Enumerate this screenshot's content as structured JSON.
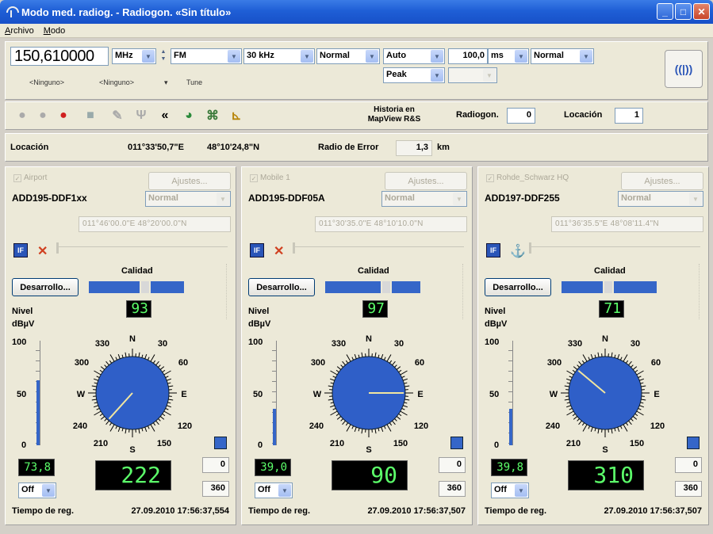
{
  "window": {
    "title": "Modo med. radiog. - Radiogon. «Sin título»",
    "controls": [
      "_",
      "□",
      "✕"
    ]
  },
  "menu": [
    "Archivo",
    "Modo"
  ],
  "receiver": {
    "frequency": "150,610000",
    "freq_unit": "MHz",
    "demod": "FM",
    "bandwidth": "30 kHz",
    "mode": "Normal",
    "agc": "Auto",
    "detector": "Peak",
    "time_value": "100,0",
    "time_unit": "ms",
    "mode2": "Normal",
    "sub1": "<Ninguno>",
    "sub2": "<Ninguno>",
    "sub_arrow": "▾",
    "sub3": "Tune"
  },
  "toolbar": {
    "historia": "Historia en MapView R&S",
    "radiogon_label": "Radiogon.",
    "radiogon_value": "0",
    "locacion_label": "Locación",
    "locacion_value": "1"
  },
  "location": {
    "label": "Locación",
    "lon": "011°33'50,7\"E",
    "lat": "48°10'24,8\"N",
    "radio_label": "Radio de Error",
    "radio_value": "1,3",
    "radio_unit": "km"
  },
  "panels": [
    {
      "station": "Airport",
      "settings": "Ajustes...",
      "device": "ADD195-DDF1xx",
      "mode": "Normal",
      "coords": "011°46'00.0\"E  48°20'00.0\"N",
      "quality_label": "Calidad",
      "quality": 0.55,
      "desarrollo": "Desarrollo...",
      "level_label": "Nivel",
      "level_unit": "dBµV",
      "level": "93",
      "scale_fill": 0.62,
      "value_small": "73,8",
      "bearing": 222,
      "bearing_text": "222",
      "box1": "0",
      "box2": "360",
      "off": "Off",
      "time_label": "Tiempo de reg.",
      "time": "27.09.2010  17:56:37,554",
      "icon2": "✕"
    },
    {
      "station": "Mobile 1",
      "settings": "Ajustes...",
      "device": "ADD195-DDF05A",
      "mode": "Normal",
      "coords": "011°30'35.0\"E  48°10'10.0\"N",
      "quality_label": "Calidad",
      "quality": 0.6,
      "desarrollo": "Desarrollo...",
      "level_label": "Nivel",
      "level_unit": "dBµV",
      "level": "97",
      "scale_fill": 0.35,
      "value_small": "39,0",
      "bearing": 90,
      "bearing_text": "90",
      "box1": "0",
      "box2": "360",
      "off": "Off",
      "time_label": "Tiempo de reg.",
      "time": "27.09.2010  17:56:37,507",
      "icon2": "✕"
    },
    {
      "station": "Rohde_Schwarz HQ",
      "settings": "Ajustes...",
      "device": "ADD197-DDF255",
      "mode": "Normal",
      "coords": "011°36'35.5\"E  48°08'11.4\"N",
      "quality_label": "Calidad",
      "quality": 0.45,
      "desarrollo": "Desarrollo...",
      "level_label": "Nivel",
      "level_unit": "dBµV",
      "level": "71",
      "scale_fill": 0.35,
      "value_small": "39,8",
      "bearing": 310,
      "bearing_text": "310",
      "box1": "0",
      "box2": "360",
      "off": "Off",
      "time_label": "Tiempo de reg.",
      "time": "27.09.2010  17:56:37,507",
      "icon2": "⚓"
    }
  ],
  "compass_labels": {
    "n": "N",
    "s": "S",
    "e": "E",
    "w": "W",
    "d30": "30",
    "d60": "60",
    "d120": "120",
    "d150": "150",
    "d210": "210",
    "d240": "240",
    "d300": "300",
    "d330": "330"
  },
  "scale_labels": {
    "top": "100",
    "mid": "50",
    "bottom": "0"
  },
  "colors": {
    "compass": "#2f5fc8",
    "needle": "#f2e6a0",
    "quality_bar": "#3566c8",
    "lcd": "#5cff6a"
  }
}
